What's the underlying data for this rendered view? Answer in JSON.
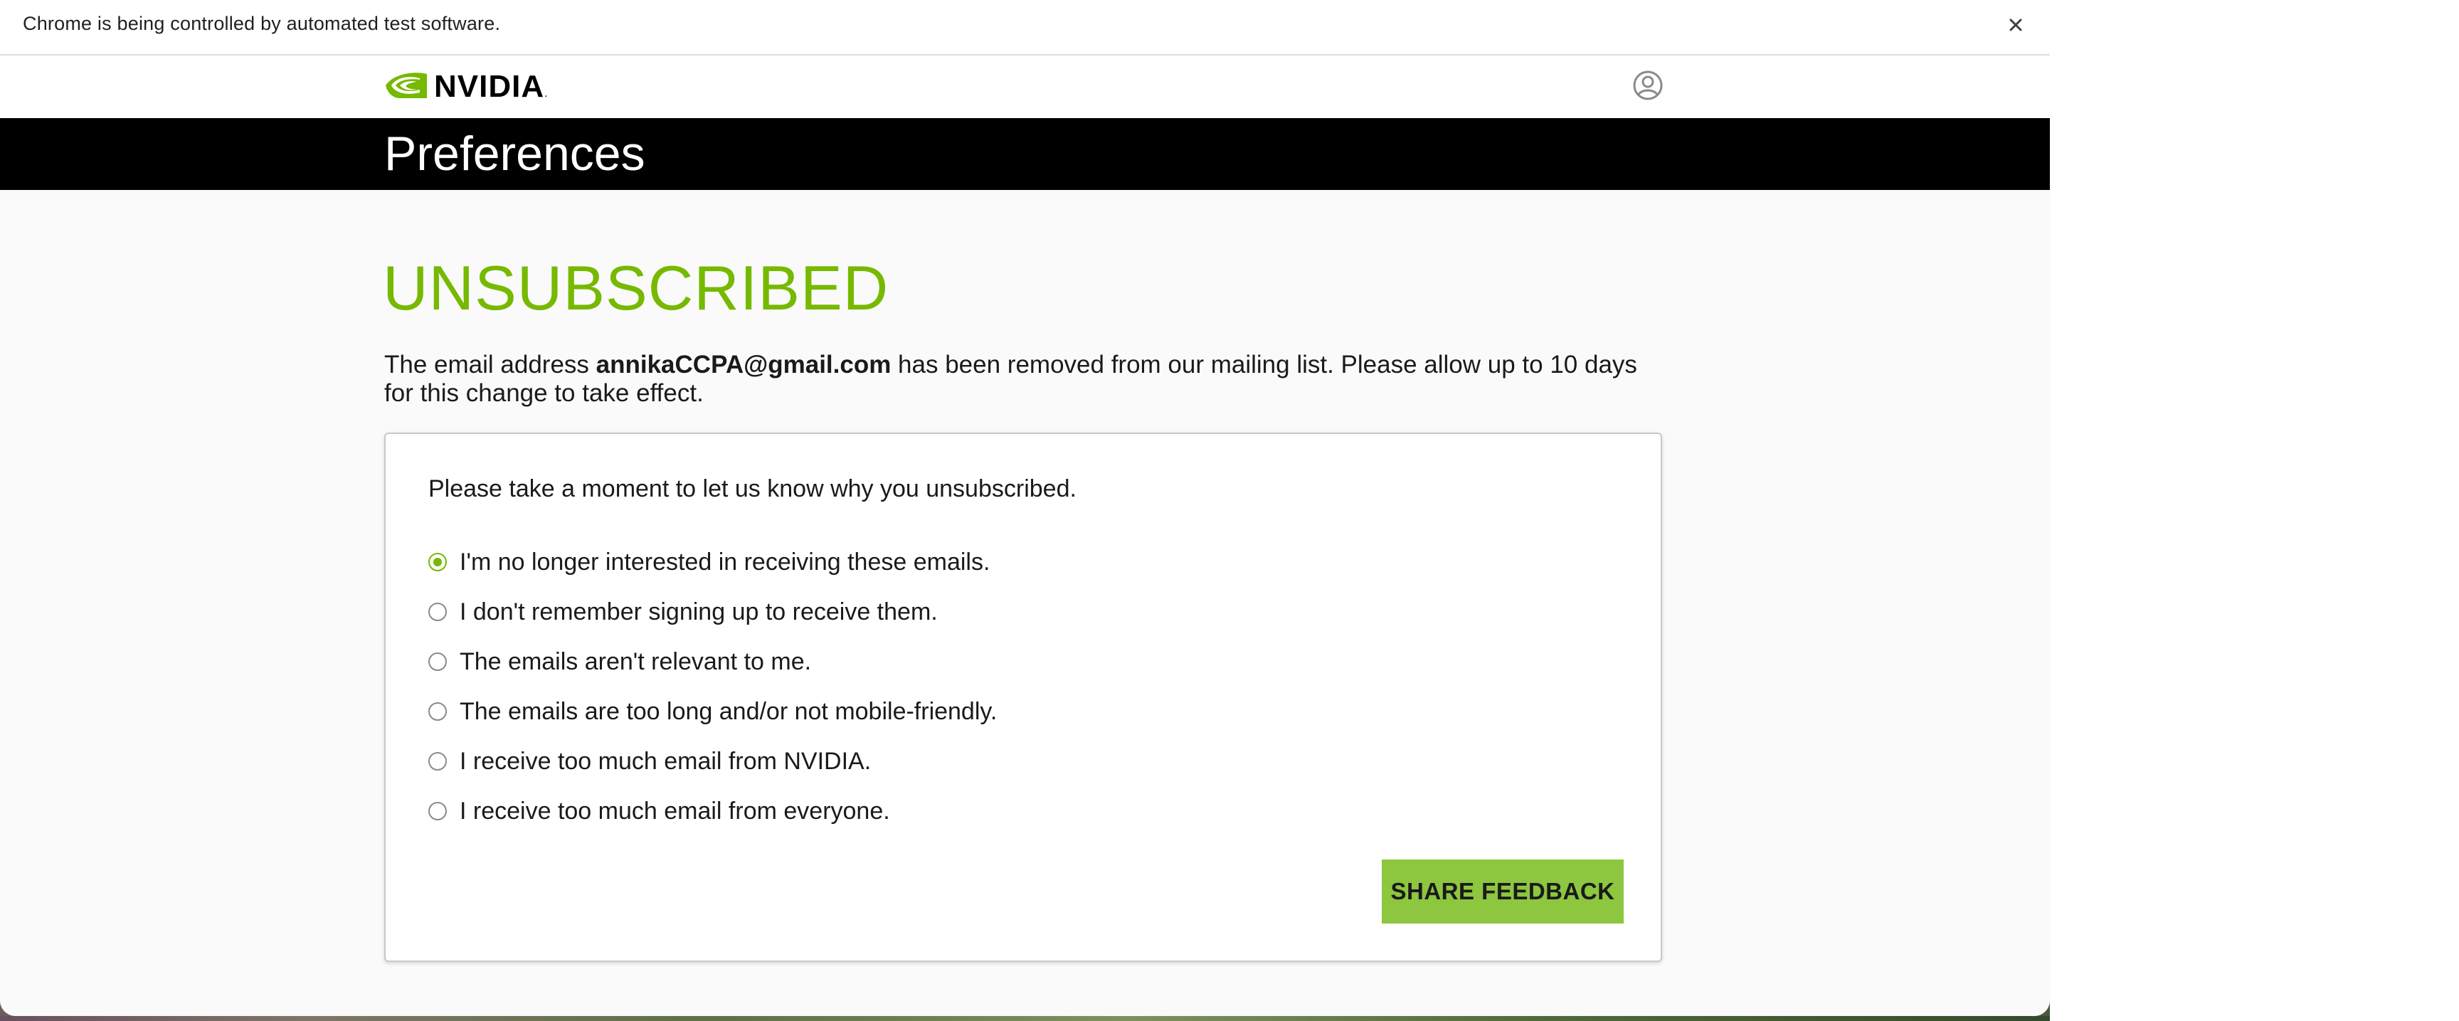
{
  "browser": {
    "infobar_text": "Chrome is being controlled by automated test software.",
    "close_icon": "close-icon"
  },
  "header": {
    "logo_text": "NVIDIA",
    "logo_suffix": ".",
    "account_icon": "user-circle-icon",
    "brand_color": "#76b900"
  },
  "title_bar": {
    "title": "Preferences"
  },
  "main": {
    "headline": "UNSUBSCRIBED",
    "message_prefix": "The email address ",
    "email": "annikaCCPA@gmail.com",
    "message_suffix": " has been removed from our mailing list. Please allow up to 10 days for this change to take effect."
  },
  "feedback": {
    "prompt": "Please take a moment to let us know why you unsubscribed.",
    "options": [
      {
        "label": "I'm no longer interested in receiving these emails.",
        "selected": true
      },
      {
        "label": "I don't remember signing up to receive them.",
        "selected": false
      },
      {
        "label": "The emails aren't relevant to me.",
        "selected": false
      },
      {
        "label": "The emails are too long and/or not mobile-friendly.",
        "selected": false
      },
      {
        "label": "I receive too much email from NVIDIA.",
        "selected": false
      },
      {
        "label": "I receive too much email from everyone.",
        "selected": false
      }
    ],
    "submit_label": "SHARE FEEDBACK",
    "button_color": "#8dc63f"
  }
}
